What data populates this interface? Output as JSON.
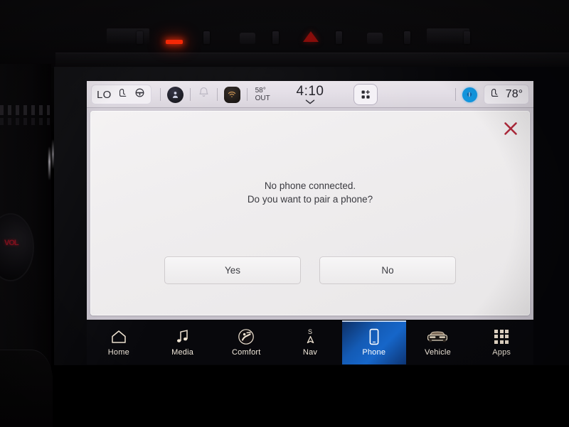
{
  "device": {
    "type": "vehicle-infotainment-touchscreen"
  },
  "status_bar": {
    "climate_low_label": "LO",
    "seat_heat_icon": "heated-seat-icon",
    "steering_heat_icon": "heated-steering-wheel-icon",
    "driver_profile_icon": "driver-profile-icon",
    "notification_icon": "bell-icon",
    "connectivity_icon": "wifi-hotspot-icon",
    "outside_temp": "58°",
    "outside_temp_label": "OUT",
    "clock": "4:10",
    "clock_chevron_icon": "chevron-down-icon",
    "apps_shortcut_icon": "grid-plus-icon",
    "bluetooth_icon": "bluetooth-status-icon",
    "passenger_seat_heat_icon": "heated-seat-icon",
    "passenger_temp": "78°"
  },
  "dialog": {
    "close_icon": "close-x-icon",
    "close_icon_color": "#b02a3c",
    "message_line1": "No phone connected.",
    "message_line2": "Do you want to pair a phone?",
    "buttons": [
      {
        "label": "Yes",
        "name": "yes-button"
      },
      {
        "label": "No",
        "name": "no-button"
      }
    ]
  },
  "bottom_nav": {
    "active_index": 4,
    "active_color": "#1666c9",
    "items": [
      {
        "label": "Home",
        "icon": "home-icon"
      },
      {
        "label": "Media",
        "icon": "music-note-icon"
      },
      {
        "label": "Comfort",
        "icon": "climate-comfort-icon"
      },
      {
        "label": "Nav",
        "icon": "compass-navigation-icon"
      },
      {
        "label": "Phone",
        "icon": "phone-smartphone-icon"
      },
      {
        "label": "Vehicle",
        "icon": "suv-vehicle-icon"
      },
      {
        "label": "Apps",
        "icon": "apps-grid-icon"
      }
    ]
  }
}
